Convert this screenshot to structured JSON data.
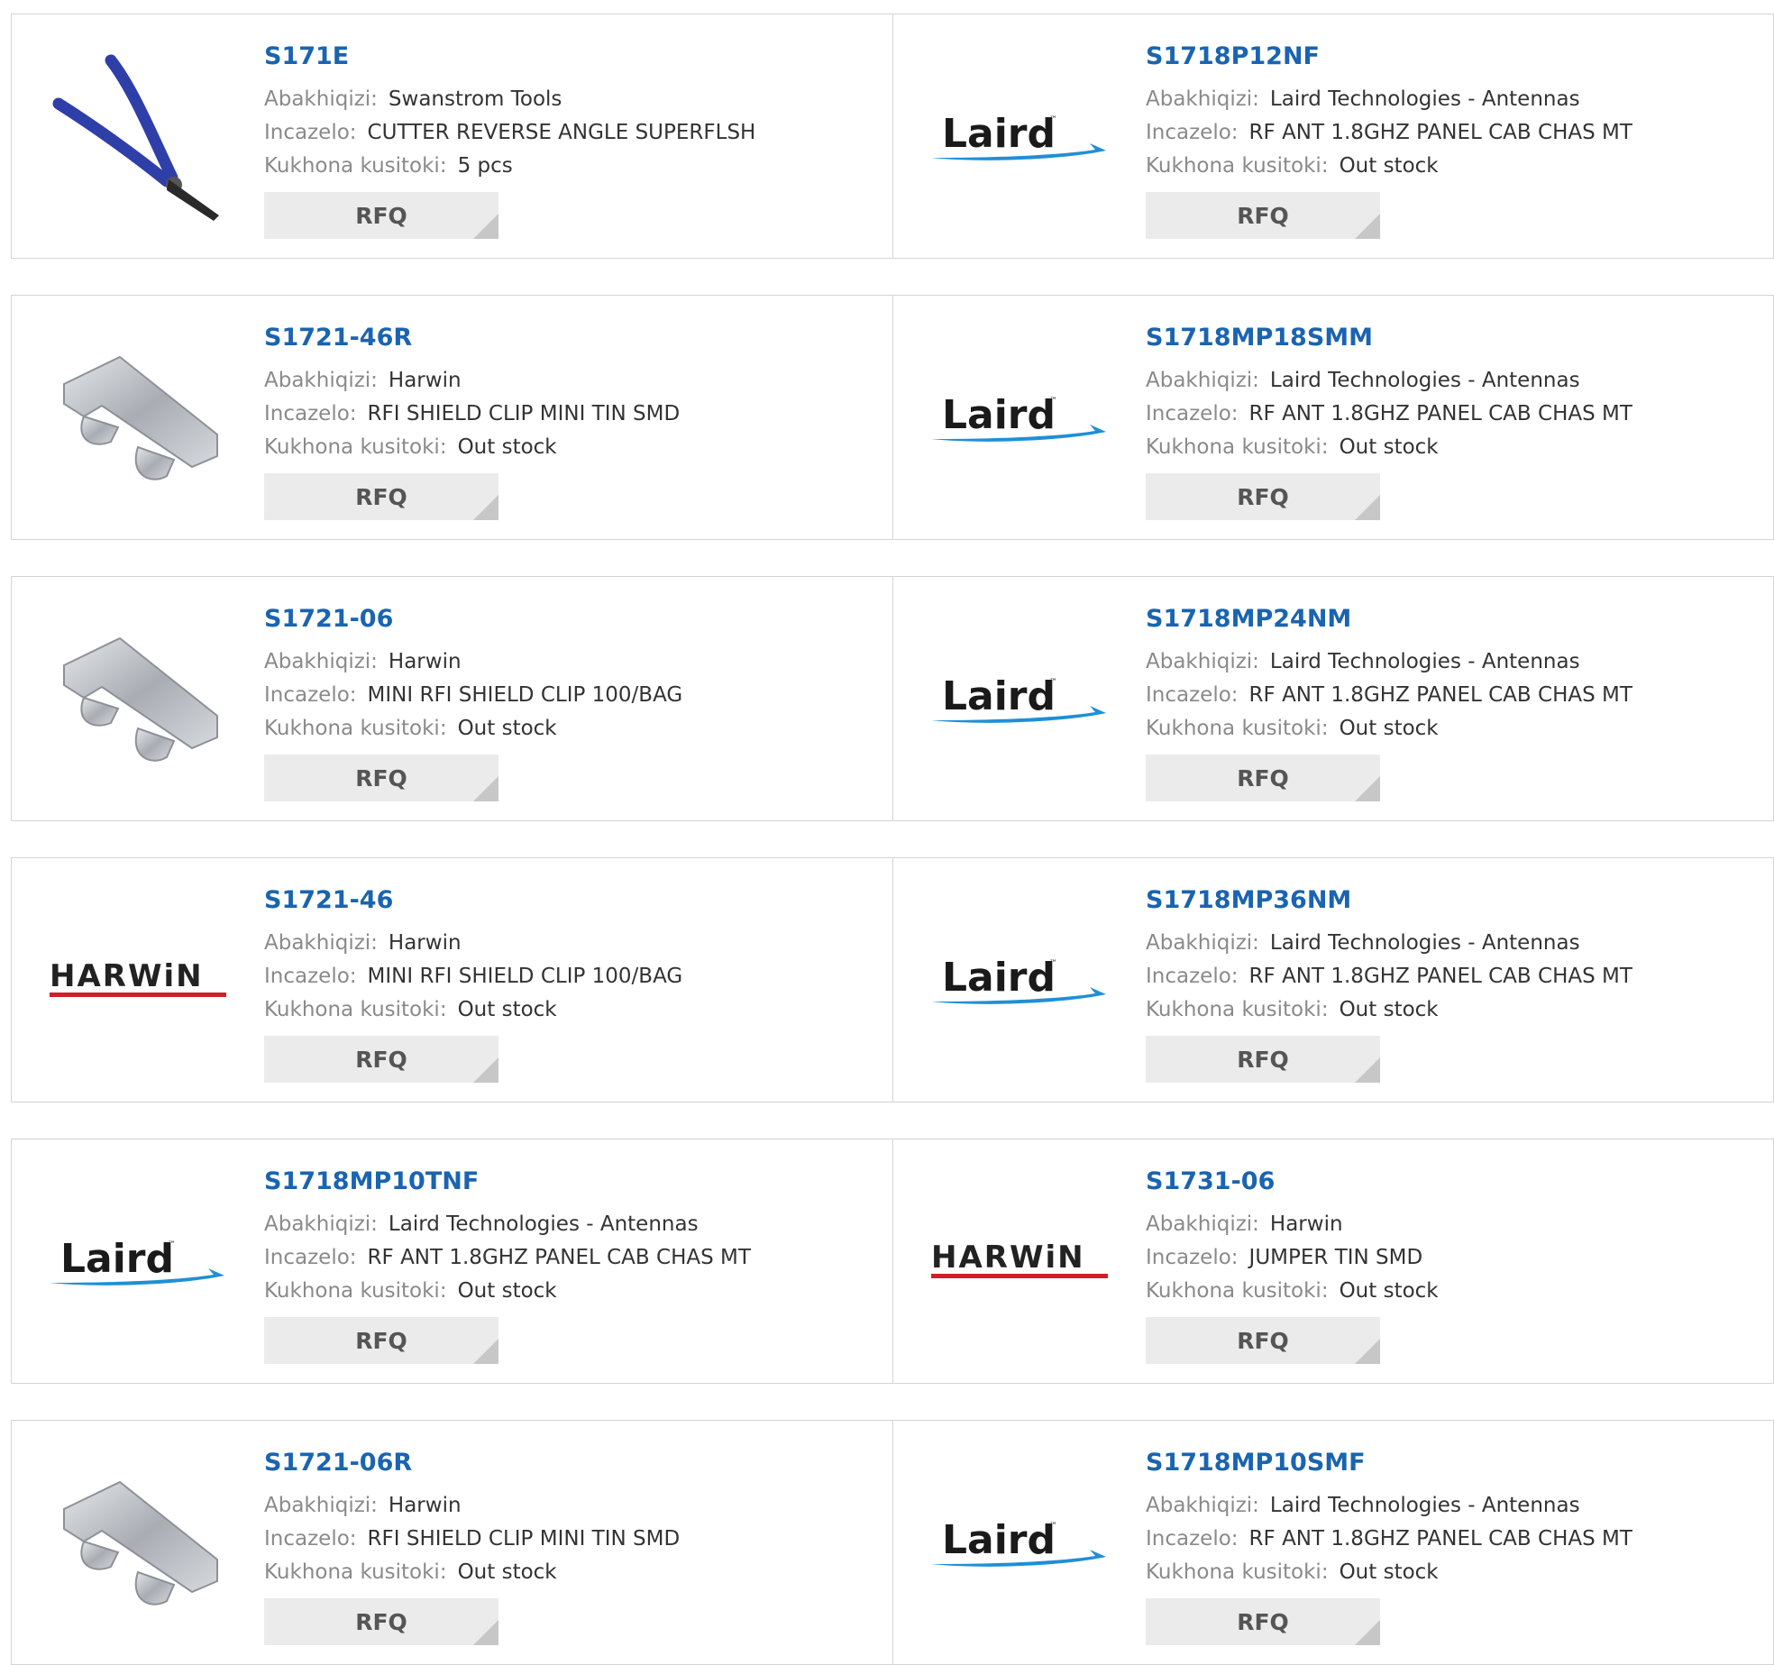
{
  "labels": {
    "manufacturer": "Abakhiqizi:",
    "description": "Incazelo:",
    "stock": "Kukhona kusitoki:",
    "rfq": "RFQ"
  },
  "brands": {
    "laird": {
      "text": "Laird",
      "tm": "™"
    },
    "harwin": {
      "text": "HARWiN"
    }
  },
  "products": [
    {
      "part": "S171E",
      "manufacturer": "Swanstrom Tools",
      "description": "CUTTER REVERSE ANGLE SUPERFLSH",
      "stock": "5 pcs",
      "image": "cutter-pliers-image"
    },
    {
      "part": "S1718P12NF",
      "manufacturer": "Laird Technologies - Antennas",
      "description": "RF ANT 1.8GHZ PANEL CAB CHAS MT",
      "stock": "Out stock",
      "image": "laird-logo"
    },
    {
      "part": "S1721-46R",
      "manufacturer": "Harwin",
      "description": "RFI SHIELD CLIP MINI TIN SMD",
      "stock": "Out stock",
      "image": "shield-clip-image"
    },
    {
      "part": "S1718MP18SMM",
      "manufacturer": "Laird Technologies - Antennas",
      "description": "RF ANT 1.8GHZ PANEL CAB CHAS MT",
      "stock": "Out stock",
      "image": "laird-logo"
    },
    {
      "part": "S1721-06",
      "manufacturer": "Harwin",
      "description": "MINI RFI SHIELD CLIP 100/BAG",
      "stock": "Out stock",
      "image": "shield-clip-image"
    },
    {
      "part": "S1718MP24NM",
      "manufacturer": "Laird Technologies - Antennas",
      "description": "RF ANT 1.8GHZ PANEL CAB CHAS MT",
      "stock": "Out stock",
      "image": "laird-logo"
    },
    {
      "part": "S1721-46",
      "manufacturer": "Harwin",
      "description": "MINI RFI SHIELD CLIP 100/BAG",
      "stock": "Out stock",
      "image": "harwin-logo"
    },
    {
      "part": "S1718MP36NM",
      "manufacturer": "Laird Technologies - Antennas",
      "description": "RF ANT 1.8GHZ PANEL CAB CHAS MT",
      "stock": "Out stock",
      "image": "laird-logo"
    },
    {
      "part": "S1718MP10TNF",
      "manufacturer": "Laird Technologies - Antennas",
      "description": "RF ANT 1.8GHZ PANEL CAB CHAS MT",
      "stock": "Out stock",
      "image": "laird-logo"
    },
    {
      "part": "S1731-06",
      "manufacturer": "Harwin",
      "description": "JUMPER TIN SMD",
      "stock": "Out stock",
      "image": "harwin-logo"
    },
    {
      "part": "S1721-06R",
      "manufacturer": "Harwin",
      "description": "RFI SHIELD CLIP MINI TIN SMD",
      "stock": "Out stock",
      "image": "shield-clip-image"
    },
    {
      "part": "S1718MP10SMF",
      "manufacturer": "Laird Technologies - Antennas",
      "description": "RF ANT 1.8GHZ PANEL CAB CHAS MT",
      "stock": "Out stock",
      "image": "laird-logo"
    }
  ],
  "colors": {
    "part_link": "#1a64b0",
    "label": "#8a8a8a",
    "value": "#333333",
    "rfq_bg": "#ebebeb",
    "border": "#d4d4d4",
    "harwin_red": "#d01f25",
    "laird_blue": "#1f8fd6",
    "plier_blue": "#2f3fa8"
  }
}
